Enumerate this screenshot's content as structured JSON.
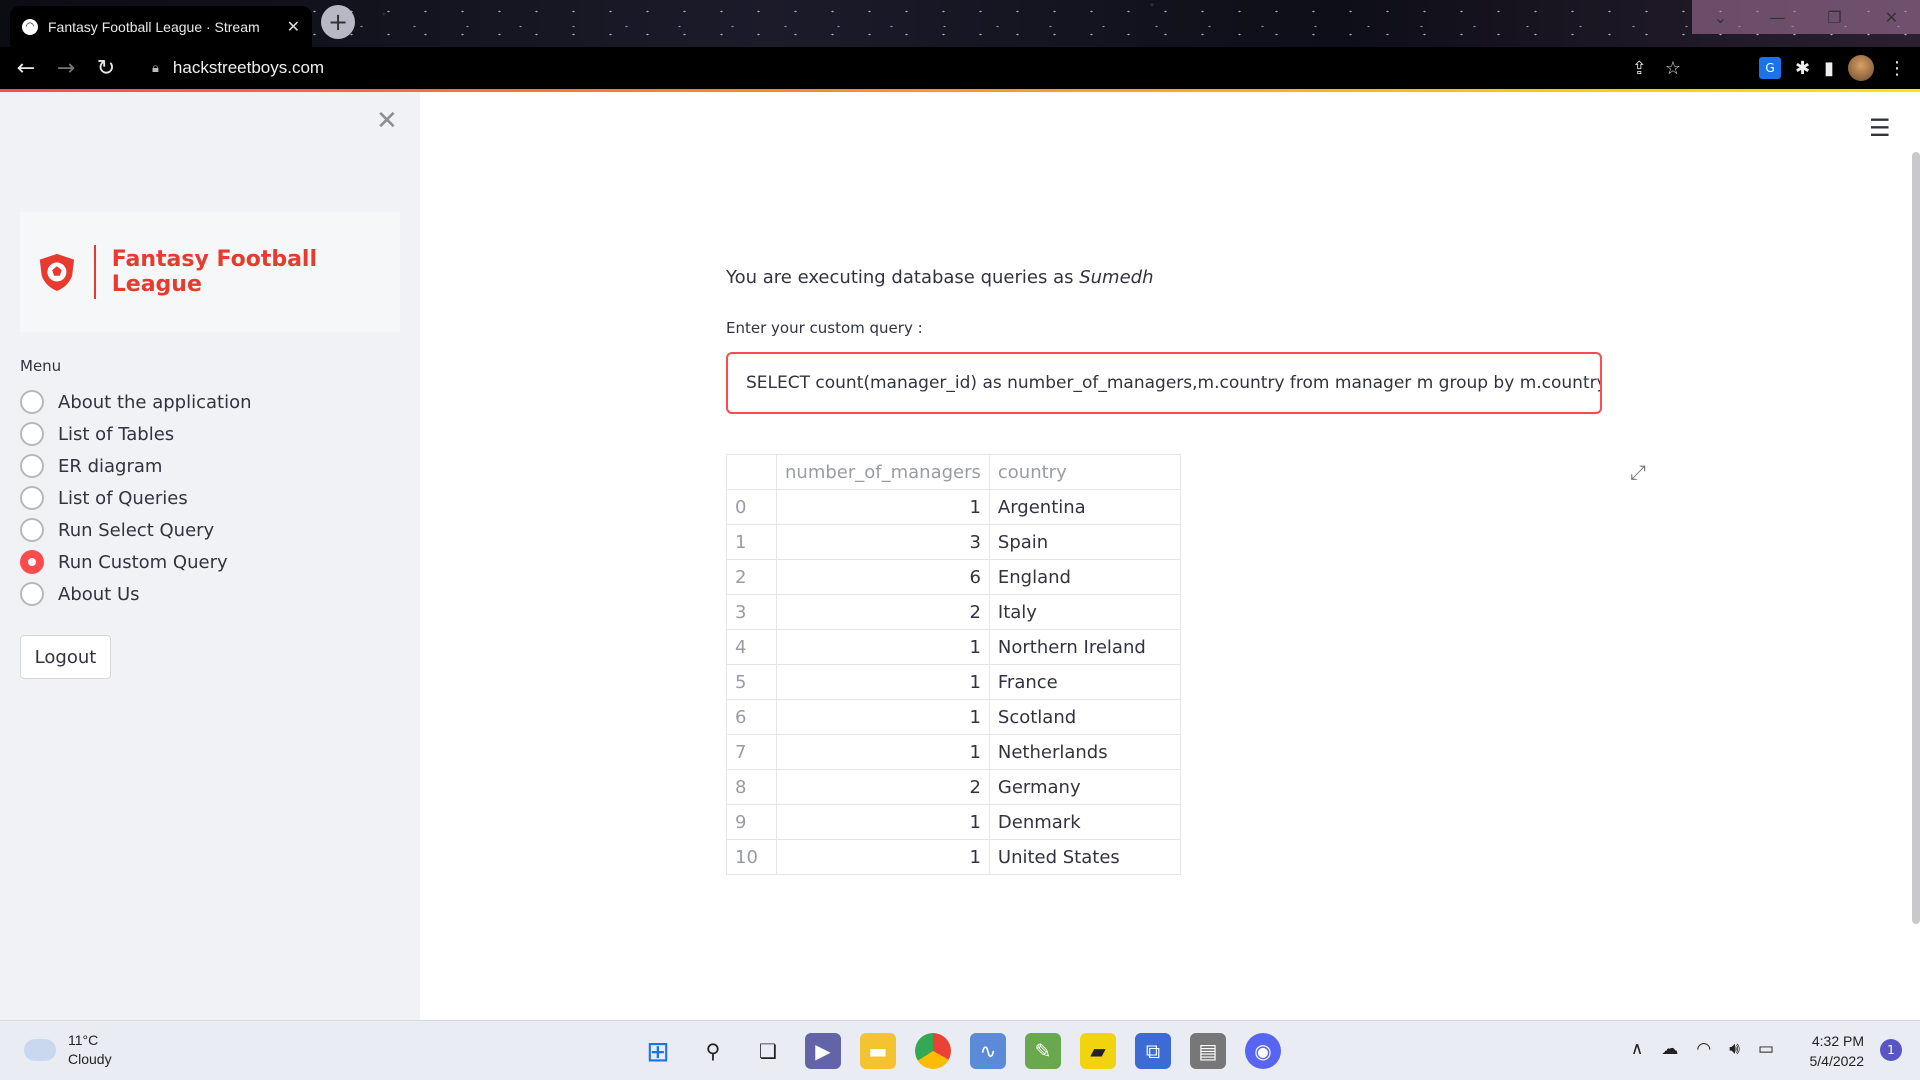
{
  "browser": {
    "tab_title": "Fantasy Football League · Stream",
    "tab_close": "✕",
    "new_tab": "+",
    "url": "hackstreetboys.com",
    "window_controls": [
      "⌄",
      "—",
      "❐",
      "✕"
    ]
  },
  "sidebar": {
    "brand": "Fantasy Football League",
    "menu_label": "Menu",
    "items": [
      {
        "label": "About the application",
        "selected": false
      },
      {
        "label": "List of Tables",
        "selected": false
      },
      {
        "label": "ER diagram",
        "selected": false
      },
      {
        "label": "List of Queries",
        "selected": false
      },
      {
        "label": "Run Select Query",
        "selected": false
      },
      {
        "label": "Run Custom Query",
        "selected": true
      },
      {
        "label": "About Us",
        "selected": false
      }
    ],
    "logout_label": "Logout",
    "accent_color": "#ff4b4b",
    "brand_color": "#e63b2e"
  },
  "main": {
    "intro_text": "You are executing database queries as ",
    "user": "Sumedh",
    "query_label": "Enter your custom query :",
    "query_value": "SELECT count(manager_id) as number_of_managers,m.country from manager m group by m.country",
    "table": {
      "columns": [
        "",
        "number_of_managers",
        "country"
      ],
      "rows": [
        [
          "0",
          "1",
          "Argentina"
        ],
        [
          "1",
          "3",
          "Spain"
        ],
        [
          "2",
          "6",
          "England"
        ],
        [
          "3",
          "2",
          "Italy"
        ],
        [
          "4",
          "1",
          "Northern Ireland"
        ],
        [
          "5",
          "1",
          "France"
        ],
        [
          "6",
          "1",
          "Scotland"
        ],
        [
          "7",
          "1",
          "Netherlands"
        ],
        [
          "8",
          "2",
          "Germany"
        ],
        [
          "9",
          "1",
          "Denmark"
        ],
        [
          "10",
          "1",
          "United States"
        ]
      ]
    }
  },
  "taskbar": {
    "temperature": "11°C",
    "weather": "Cloudy",
    "time": "4:32 PM",
    "date": "5/4/2022",
    "notification_count": "1"
  }
}
